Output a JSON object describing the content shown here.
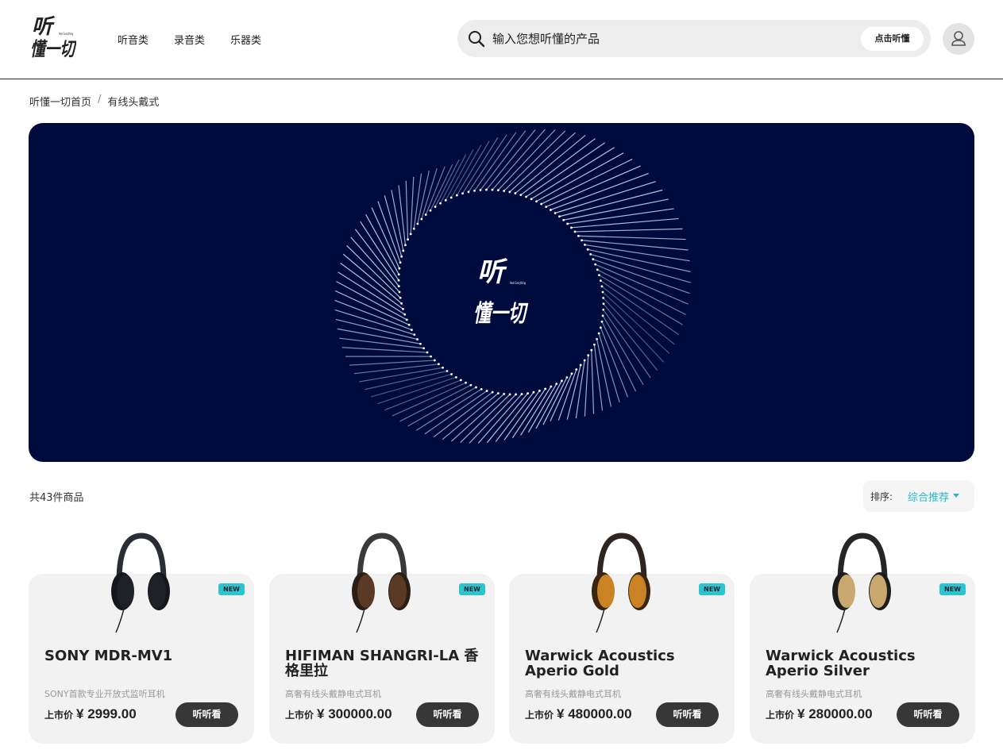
{
  "brand": {
    "logo_text_top": "听",
    "logo_text_bottom": "懂一切",
    "logo_small_text": "Hear Everything"
  },
  "nav": {
    "items": [
      {
        "label": "听音类"
      },
      {
        "label": "录音类"
      },
      {
        "label": "乐器类"
      }
    ]
  },
  "search": {
    "placeholder": "输入您想听懂的产品",
    "button_label": "点击听懂"
  },
  "breadcrumb": {
    "home": "听懂一切首页",
    "separator": "/",
    "current": "有线头戴式"
  },
  "banner": {
    "logo_top": "听",
    "logo_bottom": "懂一切",
    "logo_small": "Hear Everything",
    "background_color": "#000b3d"
  },
  "results": {
    "count_text": "共43件商品",
    "sort_label": "排序:",
    "sort_value": "综合推荐"
  },
  "colors": {
    "accent": "#26b9c9",
    "badge": "#2cc5cf",
    "button": "#373737",
    "card_bg": "#f2f2f2"
  },
  "products": [
    {
      "badge": "NEW",
      "name": "SONY MDR-MV1",
      "desc": "SONY首款专业开放式监听耳机",
      "price_label": "上市价",
      "price": "¥ 2999.00",
      "button": "听听看",
      "icon": "headphones-icon"
    },
    {
      "badge": "NEW",
      "name": "HIFIMAN SHANGRI-LA 香格里拉",
      "desc": "高奢有线头戴静电式耳机",
      "price_label": "上市价",
      "price": "¥ 300000.00",
      "button": "听听看",
      "icon": "headphones-icon"
    },
    {
      "badge": "NEW",
      "name": "Warwick Acoustics Aperio Gold",
      "desc": "高奢有线头戴静电式耳机",
      "price_label": "上市价",
      "price": "¥ 480000.00",
      "button": "听听看",
      "icon": "headphones-icon"
    },
    {
      "badge": "NEW",
      "name": "Warwick Acoustics Aperio Silver",
      "desc": "高奢有线头戴静电式耳机",
      "price_label": "上市价",
      "price": "¥ 280000.00",
      "button": "听听看",
      "icon": "headphones-icon"
    }
  ]
}
